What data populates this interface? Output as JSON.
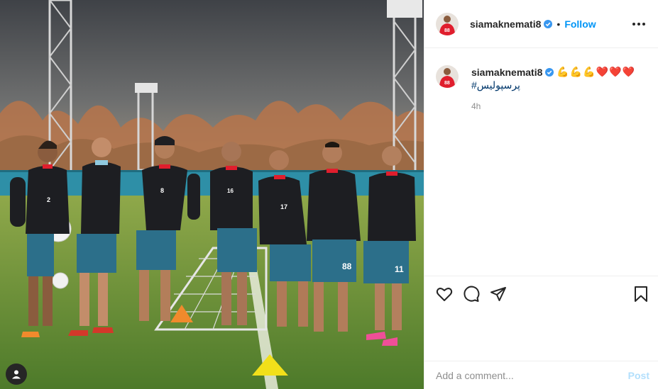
{
  "header": {
    "username": "siamaknemati8",
    "separator": "•",
    "follow_label": "Follow"
  },
  "caption": {
    "username": "siamaknemati8",
    "emojis": "💪💪💪❤️❤️❤️",
    "hashtag": "#پرسپولیس",
    "time": "4h"
  },
  "add_comment": {
    "placeholder": "Add a comment...",
    "post_label": "Post"
  },
  "photo": {
    "jersey_numbers": [
      "2",
      "8",
      "16",
      "17",
      "88",
      "11"
    ]
  },
  "colors": {
    "accent": "#0095f6",
    "jersey_red": "#e01e2d",
    "shorts_teal": "#2c6f8a"
  },
  "icons": [
    "user-tag-icon",
    "verified-icon",
    "more-options-icon",
    "heart-icon",
    "comment-icon",
    "share-icon",
    "bookmark-icon"
  ]
}
